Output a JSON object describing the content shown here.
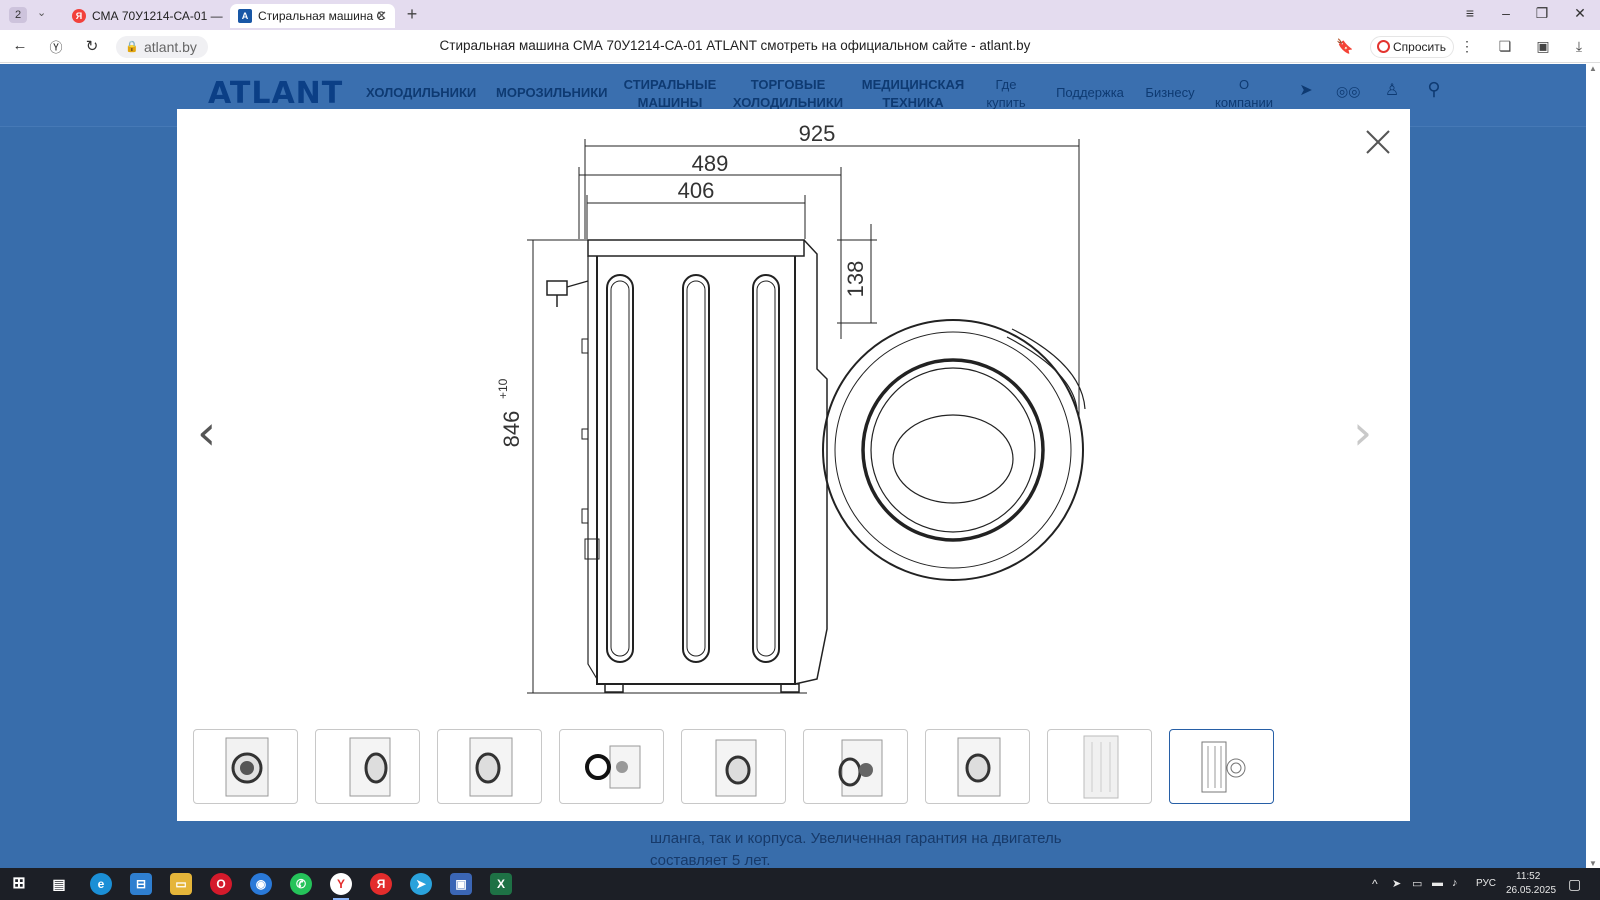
{
  "browser": {
    "tab_count": "2",
    "tabs": [
      {
        "label": "СМА 70У1214-СА-01 — Я",
        "favicon": "Я"
      },
      {
        "label": "Стиральная машина С",
        "favicon": "A"
      }
    ],
    "url": "atlant.by",
    "page_title": "Стиральная машина СМА 70У1214-СА-01 ATLANT смотреть на официальном сайте - atlant.by",
    "ask_button": "Спросить",
    "downloads_badge": "2"
  },
  "site": {
    "logo": "ATLANT",
    "nav": [
      {
        "label": "ХОЛОДИЛЬНИКИ",
        "bold": true
      },
      {
        "label": "МОРОЗИЛЬНИКИ",
        "bold": true
      },
      {
        "label": "СТИРАЛЬНЫЕ МАШИНЫ",
        "bold": true
      },
      {
        "label": "ТОРГОВЫЕ ХОЛОДИЛЬНИКИ",
        "bold": true
      },
      {
        "label": "МЕДИЦИНСКАЯ ТЕХНИКА",
        "bold": true
      },
      {
        "label": "Где купить",
        "bold": false
      },
      {
        "label": "Поддержка",
        "bold": false
      },
      {
        "label": "Бизнесу",
        "bold": false
      },
      {
        "label": "О компании",
        "bold": false
      }
    ],
    "body_text_line1": "шланга, так и корпуса. Увеличенная гарантия на двигатель",
    "body_text_line2": "составляет 5 лет."
  },
  "drawing": {
    "dim_total_width": "925",
    "dim_body_depth": "489",
    "dim_inner_depth": "406",
    "dim_top_offset": "138",
    "dim_height": "846",
    "dim_height_tolerance": "+10"
  },
  "gallery": {
    "thumb_count": 9,
    "active_index": 8
  },
  "taskbar": {
    "lang": "РУС",
    "time": "11:52",
    "date": "26.05.2025"
  }
}
